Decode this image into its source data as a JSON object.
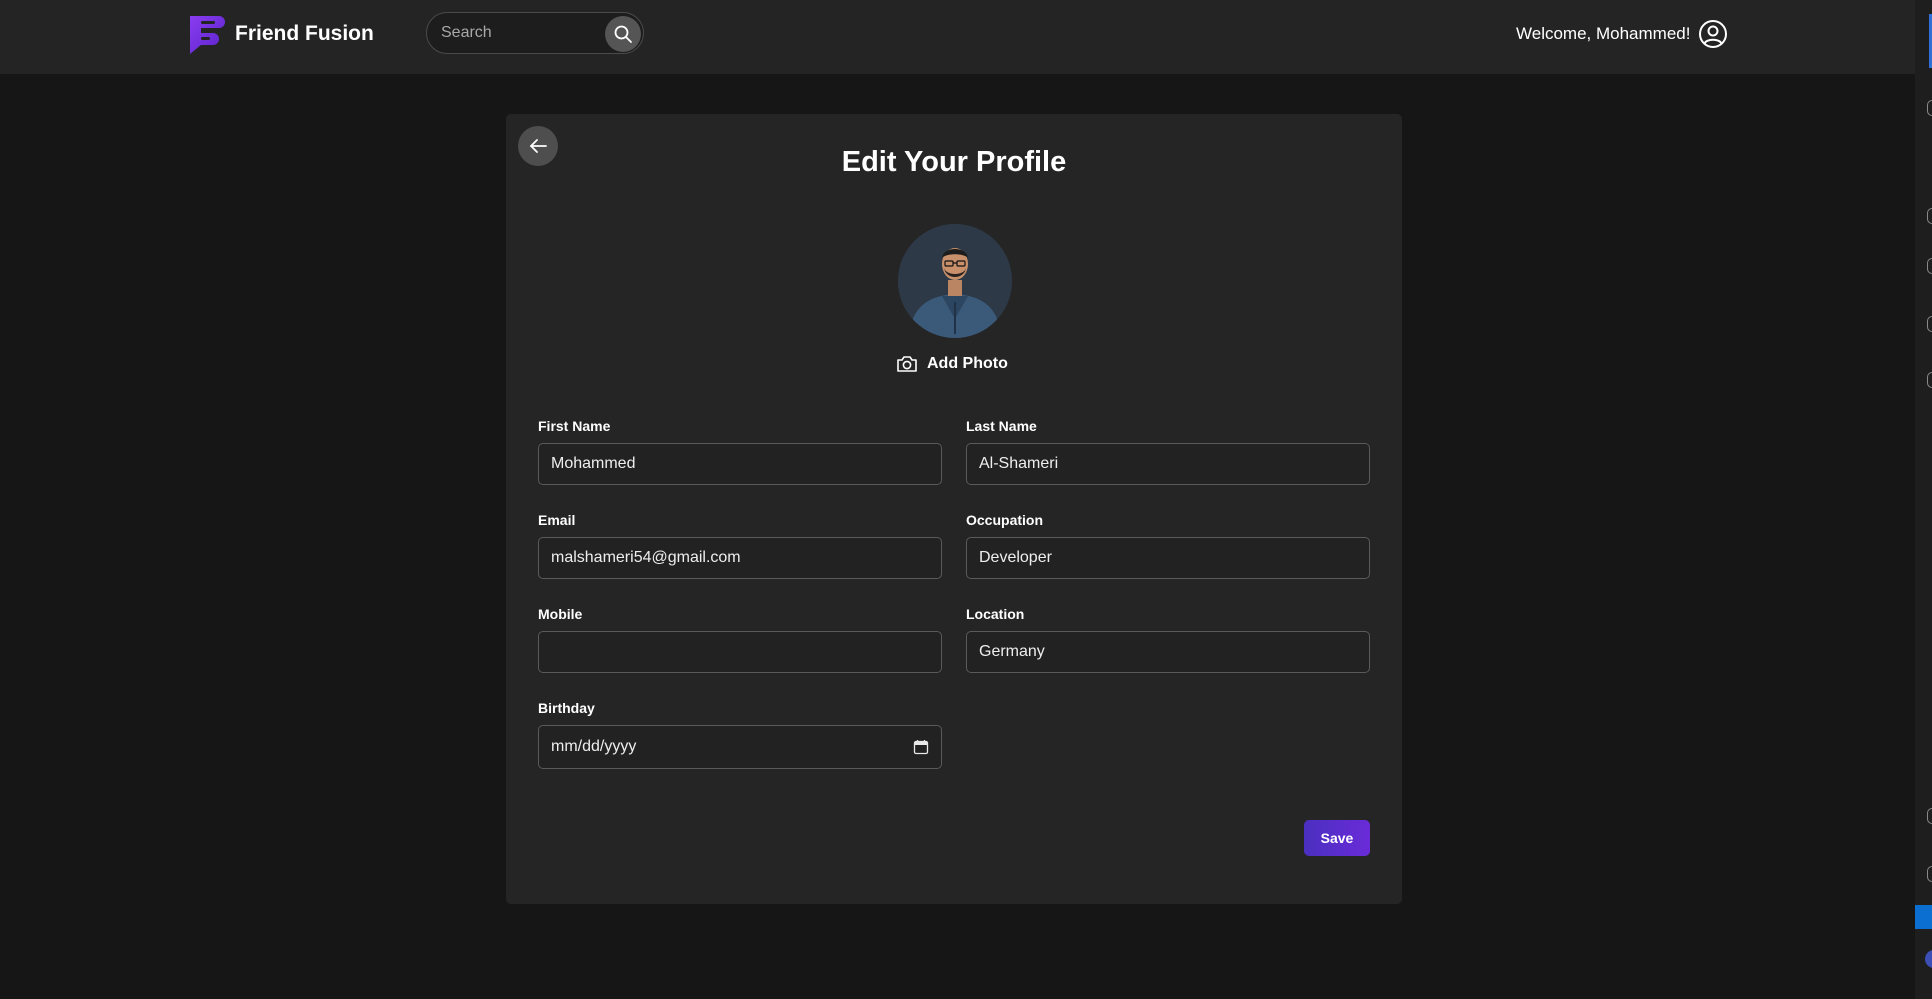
{
  "brand": {
    "name": "Friend Fusion",
    "accent_color": "#6a2bd8"
  },
  "search": {
    "placeholder": "Search",
    "value": ""
  },
  "header": {
    "welcome_text": "Welcome, Mohammed!"
  },
  "page": {
    "title": "Edit Your Profile",
    "add_photo_label": "Add Photo",
    "save_label": "Save"
  },
  "form": {
    "first_name": {
      "label": "First Name",
      "value": "Mohammed"
    },
    "last_name": {
      "label": "Last Name",
      "value": "Al-Shameri"
    },
    "email": {
      "label": "Email",
      "value": "malshameri54@gmail.com"
    },
    "occupation": {
      "label": "Occupation",
      "value": "Developer"
    },
    "mobile": {
      "label": "Mobile",
      "value": ""
    },
    "location": {
      "label": "Location",
      "value": "Germany"
    },
    "birthday": {
      "label": "Birthday",
      "value": "mm/dd/yyyy"
    }
  },
  "icons": {
    "logo": "friend-fusion-logo",
    "search": "search-icon",
    "user": "user-circle-icon",
    "back": "arrow-left-icon",
    "camera": "camera-icon",
    "calendar": "calendar-icon"
  }
}
